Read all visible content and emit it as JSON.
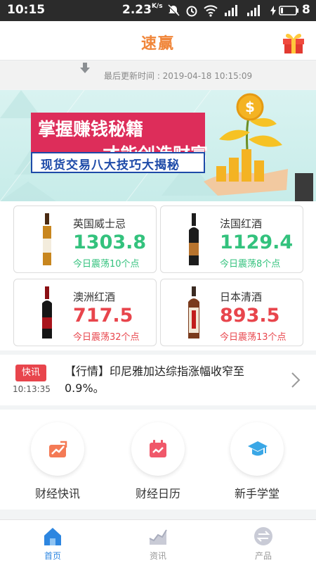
{
  "status_bar": {
    "time": "10:15",
    "net_speed": "2.23",
    "net_unit": "K/s",
    "battery": "8"
  },
  "header": {
    "title": "速赢"
  },
  "refresh": {
    "last_update": "最后更新时间 : 2019-04-18 10:15:09"
  },
  "banner": {
    "line1": "掌握赚钱秘籍",
    "line2": "才能创造财富",
    "line3": "现货交易八大技巧大揭秘"
  },
  "products": [
    {
      "name": "英国威士忌",
      "price": "1303.8",
      "change": "今日震荡10个点",
      "trend": "up"
    },
    {
      "name": "法国红酒",
      "price": "1129.4",
      "change": "今日震荡8个点",
      "trend": "up"
    },
    {
      "name": "澳洲红酒",
      "price": "717.5",
      "change": "今日震荡32个点",
      "trend": "down"
    },
    {
      "name": "日本清酒",
      "price": "893.5",
      "change": "今日震荡13个点",
      "trend": "down"
    }
  ],
  "news": {
    "badge": "快讯",
    "time": "10:13:35",
    "headline": "【行情】印尼雅加达综指涨幅收窄至0.9%。"
  },
  "quick_entries": [
    {
      "label": "财经快讯",
      "icon": "trend-chart-icon"
    },
    {
      "label": "财经日历",
      "icon": "calendar-icon"
    },
    {
      "label": "新手学堂",
      "icon": "graduation-cap-icon"
    }
  ],
  "tabs": [
    {
      "label": "首页",
      "icon": "home-icon",
      "active": true
    },
    {
      "label": "资讯",
      "icon": "chart-icon",
      "active": false
    },
    {
      "label": "产品",
      "icon": "swap-icon",
      "active": false
    }
  ],
  "colors": {
    "accent": "#f0863a",
    "up": "#33c27d",
    "down": "#e8454c",
    "tab_active": "#2d86e0"
  }
}
